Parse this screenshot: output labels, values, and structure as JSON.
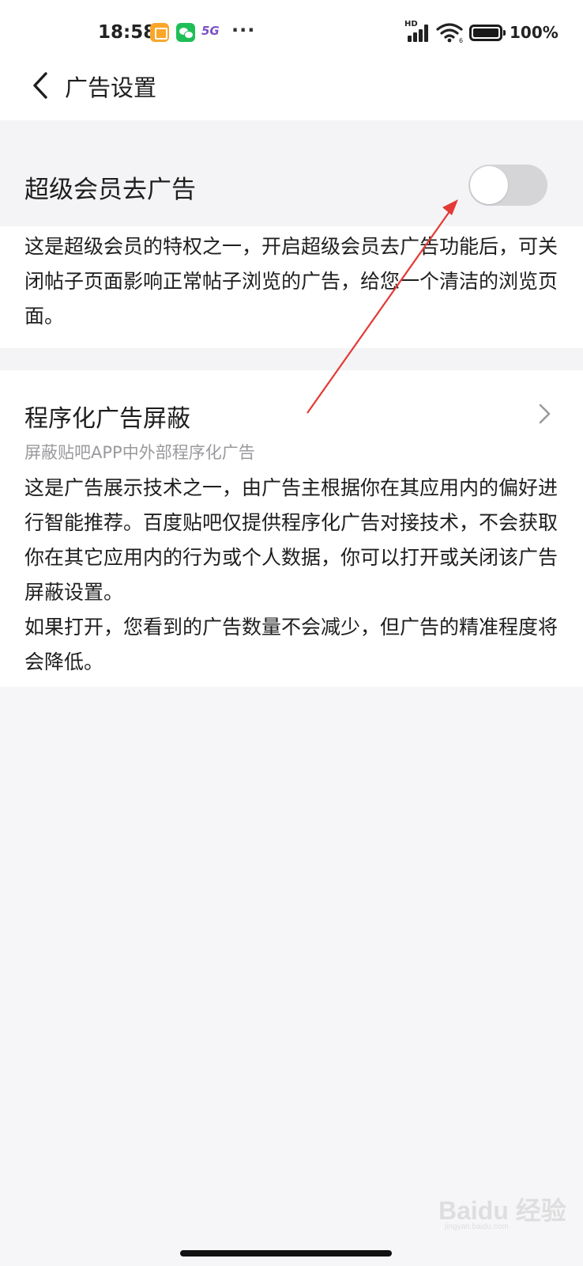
{
  "status_bar": {
    "time": "18:58",
    "network_label": "5G",
    "more": "···",
    "signal_label": "HD",
    "battery": "100%"
  },
  "header": {
    "title": "广告设置",
    "back_icon": "chevron-left-icon"
  },
  "vip_ad_free": {
    "title": "超级会员去广告",
    "toggle_on": false,
    "description": "这是超级会员的特权之一，开启超级会员去广告功能后，可关闭帖子页面影响正常帖子浏览的广告，给您一个清洁的浏览页面。"
  },
  "programmatic_ad_block": {
    "title": "程序化广告屏蔽",
    "subtitle": "屏蔽贴吧APP中外部程序化广告",
    "chevron_icon": "chevron-right-icon",
    "description": "这是广告展示技术之一，由广告主根据你在其应用内的偏好进行智能推荐。百度贴吧仅提供程序化广告对接技术，不会获取你在其它应用内的行为或个人数据，你可以打开或关闭该广告屏蔽设置。\n如果打开，您看到的广告数量不会减少，但广告的精准程度将会降低。"
  },
  "watermark": {
    "brand": "Baidu 经验",
    "url": "jingyan.baidu.com"
  },
  "colors": {
    "background": "#f6f6f8",
    "toggle_off": "#d5d5d8",
    "annotation_arrow": "#e53935",
    "subtitle_gray": "#9a9a9e"
  }
}
